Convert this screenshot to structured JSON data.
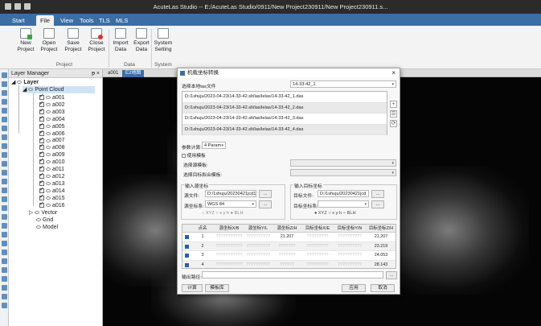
{
  "app": {
    "title": "AcuteLas Studio -- E:/AcuteLas Studio/0911/New Project230911/New Project230911.s..."
  },
  "ribbon": {
    "tabs": [
      {
        "label": "Start",
        "active": false
      },
      {
        "label": "File",
        "active": true
      },
      {
        "label": "View",
        "active": false
      },
      {
        "label": "Tools",
        "active": false
      },
      {
        "label": "TLS",
        "active": false
      },
      {
        "label": "MLS",
        "active": false
      }
    ],
    "buttons": {
      "new_project": "New Project",
      "open_project": "Open Project",
      "save_project": "Save Project",
      "close_project": "Close Project",
      "import_data": "Import Data",
      "export_data": "Export Data",
      "system_setting": "System Setting"
    },
    "groups": {
      "project": "Project",
      "data": "Data",
      "system": "System"
    }
  },
  "layer_manager": {
    "title": "Layer Manager",
    "controls": "ᵽ ×",
    "root": "Layer",
    "point_cloud": "Point Cloud",
    "items": [
      "a001",
      "a002",
      "a003",
      "a004",
      "a005",
      "a006",
      "a007",
      "a008",
      "a009",
      "a010",
      "a011",
      "a012",
      "a013",
      "a014",
      "a015",
      "a016"
    ],
    "vector": "Vector",
    "grid": "Grid",
    "model": "Model"
  },
  "doc_tabs": [
    "a001",
    "E2地图"
  ],
  "dialog": {
    "title": "机载坐标转换",
    "close": "×",
    "select_label": "选择本地tas文件",
    "select_value": "14-33-42_1",
    "files": [
      "D:/1shuju/2023-04-23/14-33-42.slt/las/lelas/14-33-42_1.das",
      "D:/1shuju/2023-04-23/14-33-42.slt/las/lelas/14-33-42_2.das",
      "D:/1shuju/2023-04-23/14-33-42.slt/las/lelas/14-33-42_3.das",
      "D:/1shuju/2023-04-23/14-33-42.slt/las/lelas/14-33-42_4.das"
    ],
    "side_buttons": [
      "+",
      "☰",
      "⟳"
    ],
    "param_label": "参数计算:",
    "param_value": "4 Param",
    "checkbox_label": "使用模板",
    "template_a_label": "选择源模板:",
    "template_b_label": "选择目标拟合模板:",
    "source": {
      "group_title": "输入源坐标",
      "file_label": "源文件:",
      "file_value": "D:/1shuju/20230421jcd1.t",
      "btn": "...",
      "crs_label": "源坐标系:",
      "crs_value": "WGS 84",
      "radios": "○ XYZ  ○ x y h  ● BLH"
    },
    "target": {
      "group_title": "输入目标坐标",
      "file_label": "目标文件:",
      "file_value": "D:/1shuju/20230421jcd",
      "btn": "...",
      "crs_label": "目标坐标系:",
      "crs_value": "",
      "radios": "● XYZ  ○ x y h  ○ BLH"
    },
    "table": {
      "headers": [
        "点名",
        "源坐标X/B",
        "源坐标Y/L",
        "源坐标Z/H",
        "目标坐标X/E",
        "目标坐标Y/N",
        "目标坐标Z/H"
      ],
      "rows": [
        {
          "id": "1",
          "c1": "???????????",
          "c2": "??????????",
          "c3": "21.207",
          "c4": "?????????",
          "c5": "??????????",
          "c6": "21.207"
        },
        {
          "id": "2",
          "c1": "???????????",
          "c2": "??????????",
          "c3": "???????",
          "c4": "?????????",
          "c5": "??????????",
          "c6": "23.219"
        },
        {
          "id": "3",
          "c1": "???????????",
          "c2": "??????????",
          "c3": "???????",
          "c4": "?????????",
          "c5": "??????????",
          "c6": "24.053"
        },
        {
          "id": "4",
          "c1": "???????????",
          "c2": "??????????",
          "c3": "??????",
          "c4": "?????????",
          "c5": "??????????",
          "c6": "28.143"
        }
      ]
    },
    "output_label": "输出路径:",
    "output_btn": "...",
    "calc_btn": "计算",
    "save_btn": "模板库",
    "apply_btn": "应用",
    "cancel_btn": "取消"
  }
}
